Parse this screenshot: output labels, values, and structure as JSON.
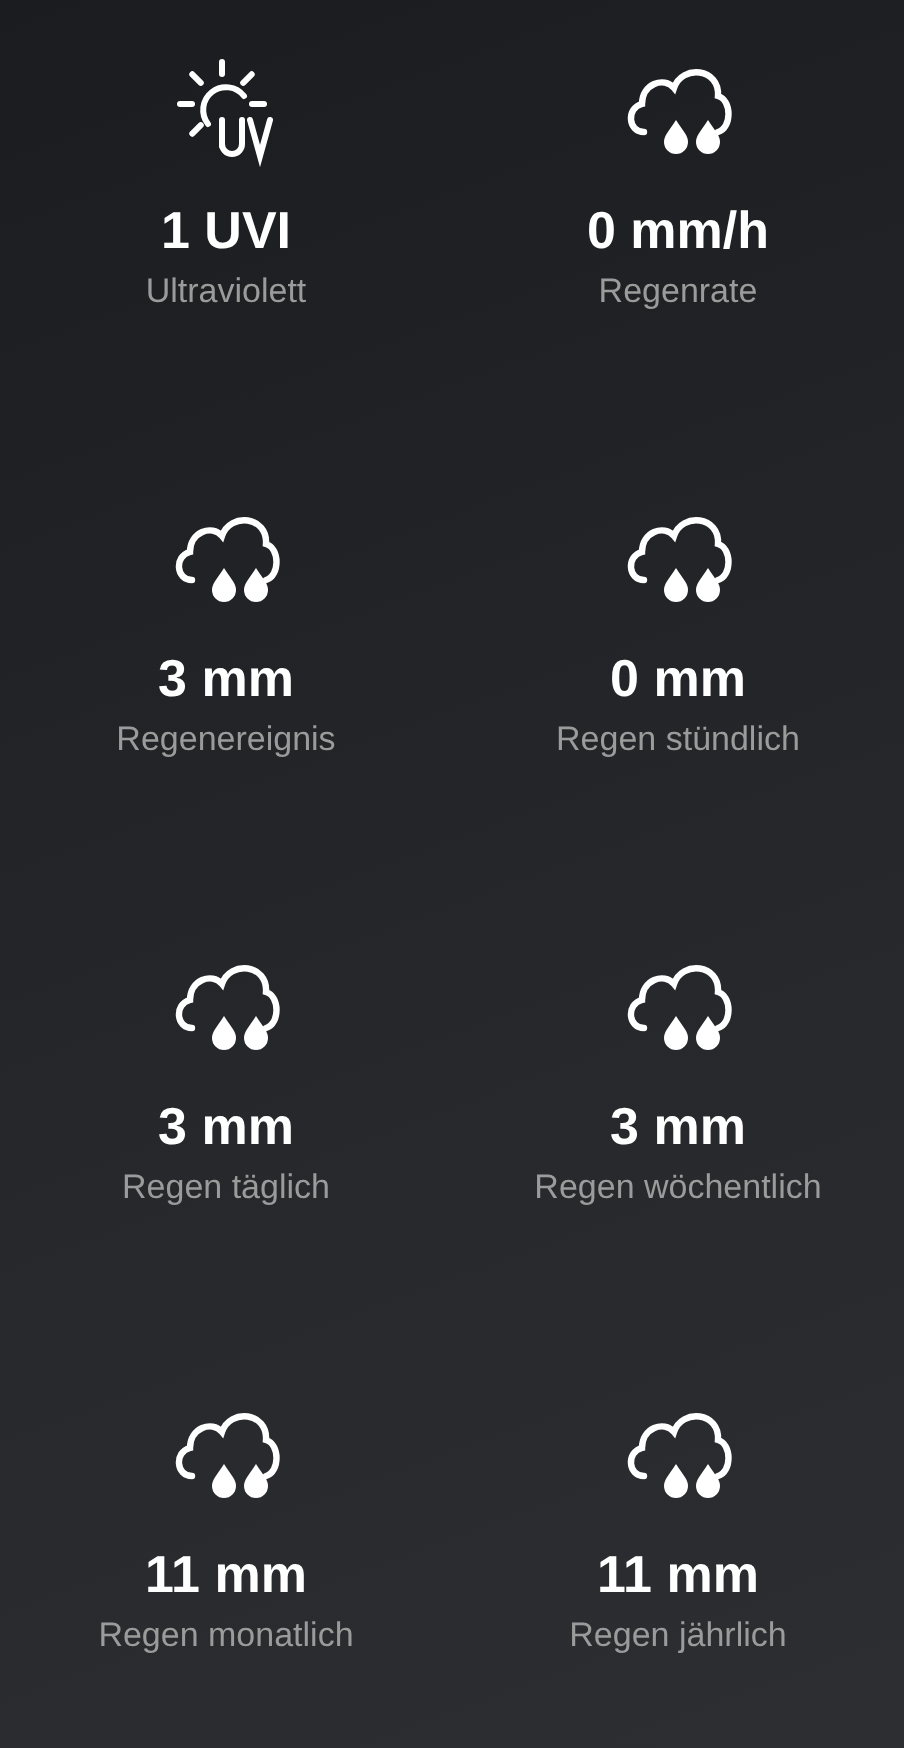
{
  "tiles": [
    {
      "kind": "uv",
      "value": "1 UVI",
      "label": "Ultraviolett"
    },
    {
      "kind": "rain",
      "value": "0 mm/h",
      "label": "Regenrate"
    },
    {
      "kind": "rain",
      "value": "3 mm",
      "label": "Regenereignis"
    },
    {
      "kind": "rain",
      "value": "0 mm",
      "label": "Regen stündlich"
    },
    {
      "kind": "rain",
      "value": "3 mm",
      "label": "Regen täglich"
    },
    {
      "kind": "rain",
      "value": "3 mm",
      "label": "Regen wöchentlich"
    },
    {
      "kind": "rain",
      "value": "11 mm",
      "label": "Regen monatlich"
    },
    {
      "kind": "rain",
      "value": "11 mm",
      "label": "Regen jährlich"
    }
  ]
}
